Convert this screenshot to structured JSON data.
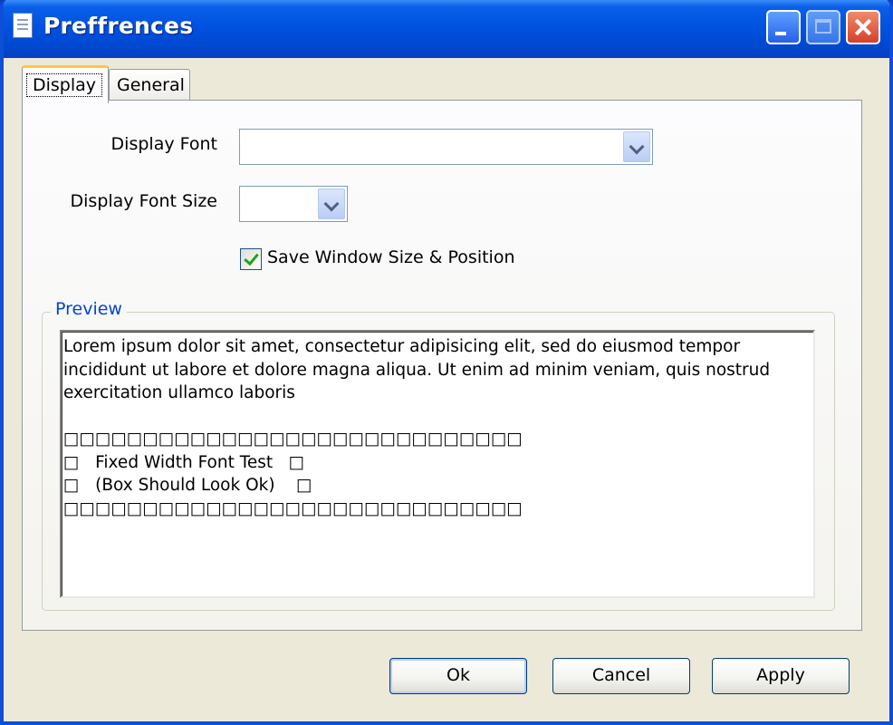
{
  "window": {
    "title": "Preffrences"
  },
  "tabs": [
    {
      "label": "Display",
      "selected": true
    },
    {
      "label": "General",
      "selected": false
    }
  ],
  "display": {
    "font_label": "Display Font",
    "font_value": "",
    "font_size_label": "Display Font Size",
    "font_size_value": "",
    "save_window_label": "Save Window Size & Position",
    "save_window_checked": true,
    "preview_group_label": "Preview",
    "preview_text": "Lorem ipsum dolor sit amet, consectetur adipisicing elit, sed do eiusmod tempor\nincididunt ut labore et dolore magna aliqua. Ut enim ad minim veniam, quis nostrud\nexercitation ullamco laboris\n\n□□□□□□□□□□□□□□□□□□□□□□□□□□□□□\n□   Fixed Width Font Test   □\n□   (Box Should Look Ok)    □\n□□□□□□□□□□□□□□□□□□□□□□□□□□□□□"
  },
  "buttons": {
    "ok": "Ok",
    "cancel": "Cancel",
    "apply": "Apply"
  },
  "colors": {
    "titlebar": "#0052e0",
    "dialog_bg": "#ece9d8",
    "group_title": "#0046d5",
    "check_mark": "#21a121",
    "active_tab_accent": "#ffc73c"
  }
}
